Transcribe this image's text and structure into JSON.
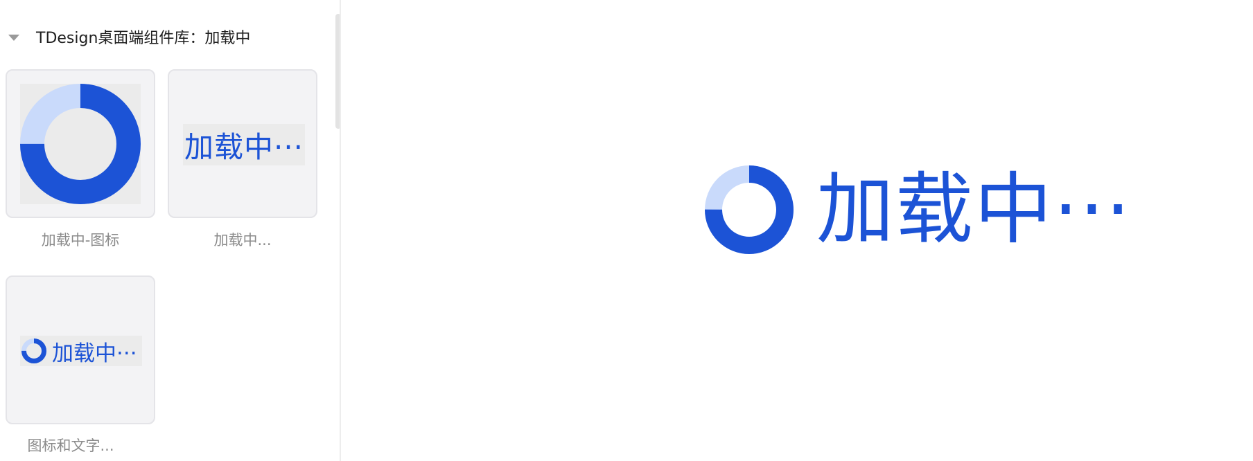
{
  "sidebar": {
    "group_title": "TDesign桌面端组件库：加载中",
    "items": [
      {
        "caption": "加载中-图标",
        "thumb_text": ""
      },
      {
        "caption": "加载中...",
        "thumb_text": "加载中···"
      },
      {
        "caption": "图标和文字...",
        "thumb_text": "加载中···"
      }
    ]
  },
  "preview": {
    "text": "加载中···"
  },
  "colors": {
    "primary": "#1c53d6",
    "track": "#c9dafb",
    "tile_bg": "#f3f3f5",
    "caption": "#8a8a8a"
  },
  "icons": {
    "caret": "caret-down-icon",
    "spinner": "loading-spinner-icon"
  }
}
